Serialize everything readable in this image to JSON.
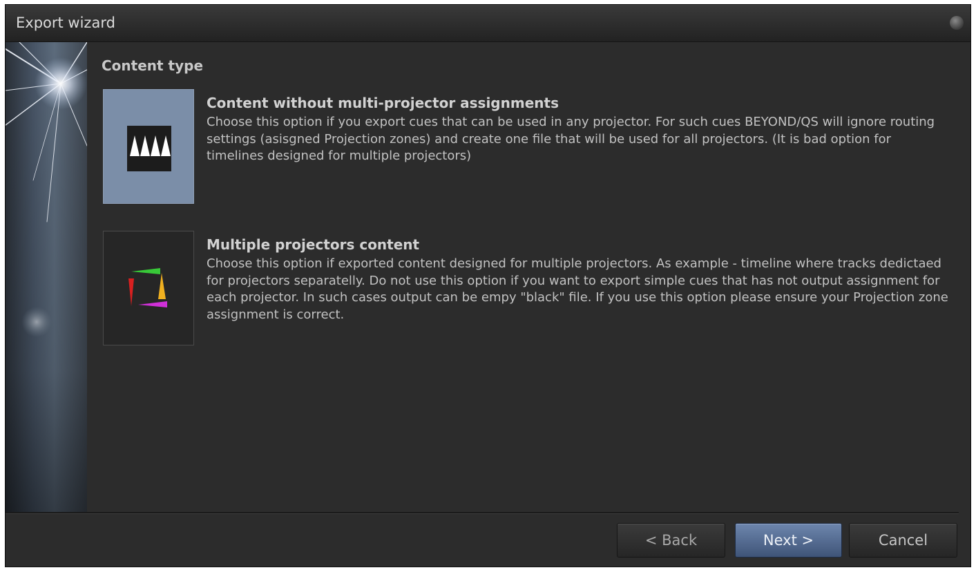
{
  "window": {
    "title": "Export wizard"
  },
  "page": {
    "heading": "Content type"
  },
  "options": [
    {
      "title": "Content without multi-projector assignments",
      "description": "Choose this option if you export cues that can be used in any projector.  For such cues BEYOND/QS will ignore routing settings (asisgned Projection zones) and create one file that will be used for all projectors. (It is bad option for timelines designed for multiple projectors)",
      "icon": "single-projector-icon",
      "selected": true
    },
    {
      "title": "Multiple projectors content",
      "description": "Choose this option if exported content designed for multiple projectors. As example - timeline where tracks dedictaed for projectors separatelly. Do not use this option if you want to export simple cues that has not output assignment for each projector. In such cases output can be empy \"black\" file. If you use this option please ensure your Projection zone assignment is correct.",
      "icon": "multi-projector-icon",
      "selected": false
    }
  ],
  "buttons": {
    "back": "< Back",
    "next": "Next >",
    "cancel": "Cancel"
  },
  "colors": {
    "background": "#2c2c2c",
    "selected_thumb": "#7b8ea8",
    "primary_button": "#4f6890"
  }
}
